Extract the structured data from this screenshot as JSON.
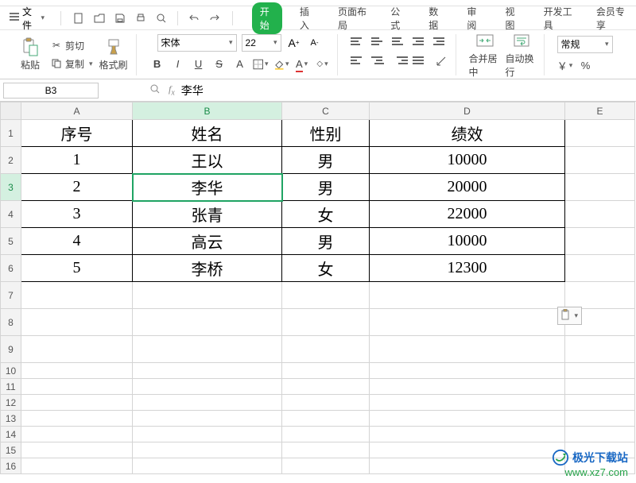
{
  "menu": {
    "file": "文件",
    "tabs": [
      "开始",
      "插入",
      "页面布局",
      "公式",
      "数据",
      "审阅",
      "视图",
      "开发工具",
      "会员专享"
    ]
  },
  "ribbon": {
    "paste": "粘贴",
    "cut": "剪切",
    "copy": "复制",
    "formatpainter": "格式刷",
    "fontname": "宋体",
    "fontsize": "22",
    "merge": "合并居中",
    "wrap": "自动换行",
    "numfmt": "常规"
  },
  "namebox": "B3",
  "formula": "李华",
  "columns": [
    "A",
    "B",
    "C",
    "D",
    "E"
  ],
  "table": {
    "header": {
      "seq": "序号",
      "name": "姓名",
      "gender": "性别",
      "perf": "绩效"
    },
    "rows": [
      {
        "seq": "1",
        "name": "王以",
        "gender": "男",
        "perf": "10000"
      },
      {
        "seq": "2",
        "name": "李华",
        "gender": "男",
        "perf": "20000"
      },
      {
        "seq": "3",
        "name": "张青",
        "gender": "女",
        "perf": "22000"
      },
      {
        "seq": "4",
        "name": "高云",
        "gender": "男",
        "perf": "10000"
      },
      {
        "seq": "5",
        "name": "李桥",
        "gender": "女",
        "perf": "12300"
      }
    ]
  },
  "currency": "￥",
  "watermark": {
    "line1": "极光下载站",
    "line2": "www.xz7.com"
  }
}
